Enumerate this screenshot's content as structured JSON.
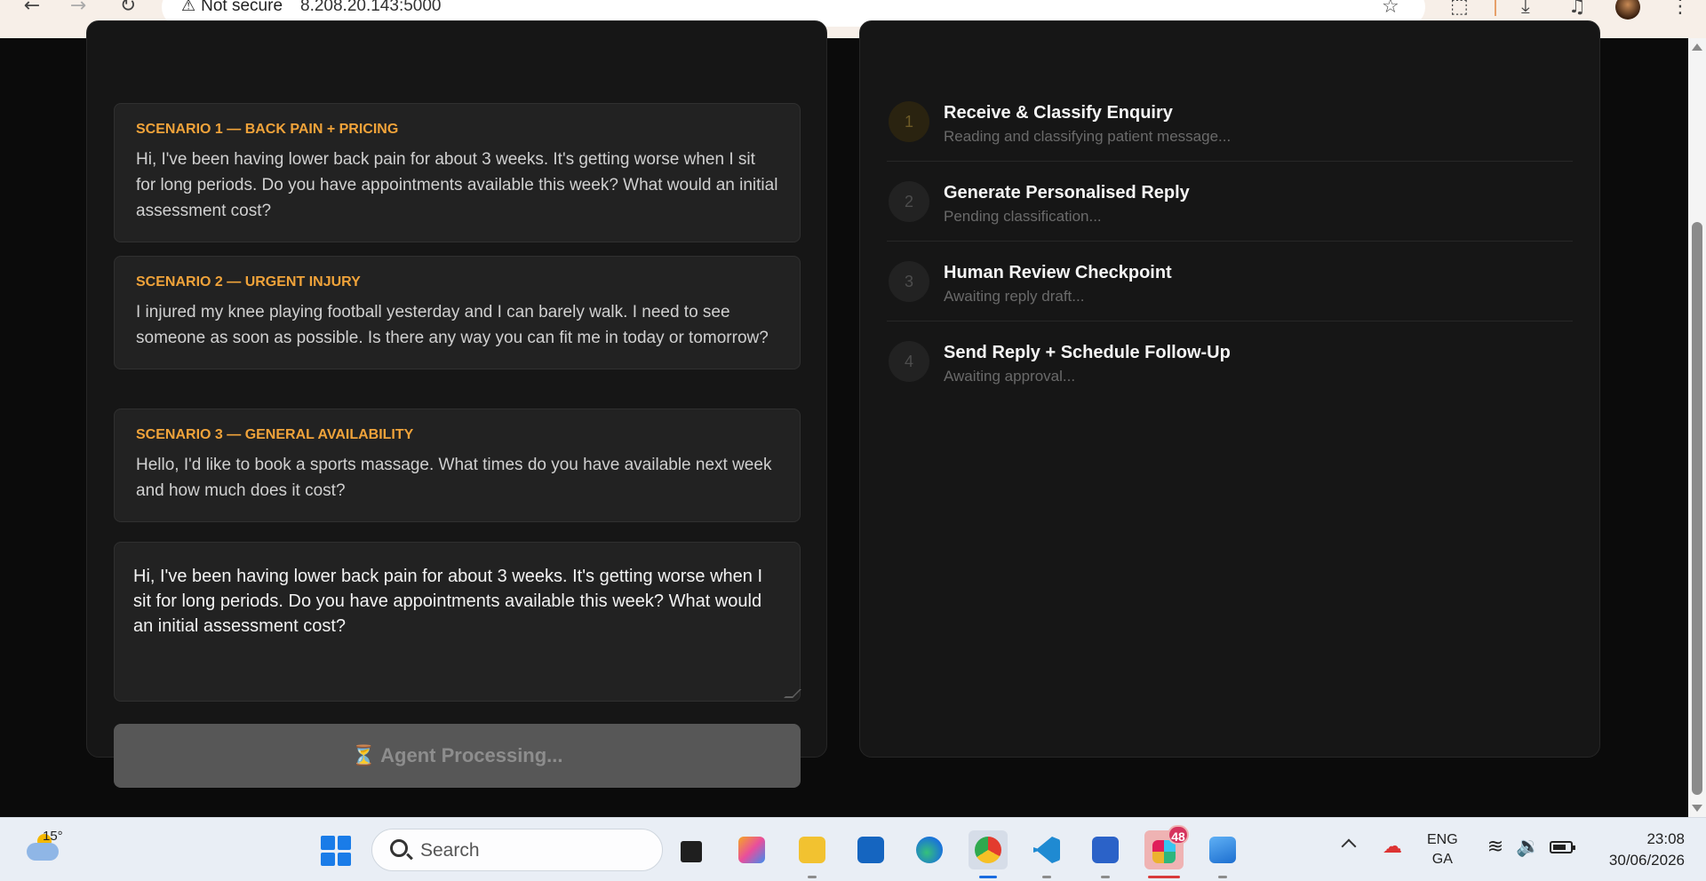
{
  "browser": {
    "security_label": "Not secure",
    "url": "8.208.20.143:5000"
  },
  "scenarios": [
    {
      "title": "SCENARIO 1 — BACK PAIN + PRICING",
      "text": "Hi, I've been having lower back pain for about 3 weeks. It's getting worse when I sit for long periods. Do you have appointments available this week? What would an initial assessment cost?"
    },
    {
      "title": "SCENARIO 2 — URGENT INJURY",
      "text": "I injured my knee playing football yesterday and I can barely walk. I need to see someone as soon as possible. Is there any way you can fit me in today or tomorrow?"
    },
    {
      "title": "SCENARIO 3 — GENERAL AVAILABILITY",
      "text": "Hello, I'd like to book a sports massage. What times do you have available next week and how much does it cost?"
    }
  ],
  "message_input": {
    "value": "Hi, I've been having lower back pain for about 3 weeks. It's getting worse when I sit for long periods. Do you have appointments available this week? What would an initial assessment cost?"
  },
  "process_button": {
    "label": "⏳ Agent Processing..."
  },
  "steps": [
    {
      "number": "1",
      "title": "Receive & Classify Enquiry",
      "subtitle": "Reading and classifying patient message..."
    },
    {
      "number": "2",
      "title": "Generate Personalised Reply",
      "subtitle": "Pending classification..."
    },
    {
      "number": "3",
      "title": "Human Review Checkpoint",
      "subtitle": "Awaiting reply draft..."
    },
    {
      "number": "4",
      "title": "Send Reply + Schedule Follow-Up",
      "subtitle": "Awaiting approval..."
    }
  ],
  "taskbar": {
    "temperature": "15°",
    "search_placeholder": "Search",
    "slack_badge": "48",
    "language": "ENG",
    "layout": "GA",
    "time": "23:08",
    "date": "30/06/2026"
  },
  "colors": {
    "accent_orange": "#f0a33a",
    "panel_bg": "#161616",
    "card_bg": "#222222",
    "page_bg": "#0b0b0b"
  }
}
